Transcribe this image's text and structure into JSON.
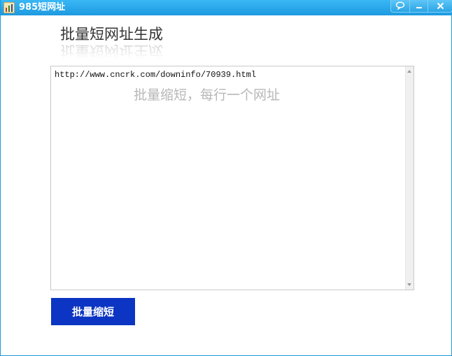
{
  "window": {
    "title": "985短网址",
    "controls": {
      "feedback_icon": "speech-bubble-icon",
      "minimize_icon": "minimize-icon",
      "close_icon": "close-icon"
    },
    "titlebar_color": "#1e9ae0"
  },
  "main": {
    "heading": "批量短网址生成",
    "textarea": {
      "value": "http://www.cncrk.com/downinfo/70939.html",
      "hint": "批量缩短，每行一个网址"
    },
    "shorten_button": {
      "label": "批量缩短",
      "color": "#0b35c2"
    }
  }
}
